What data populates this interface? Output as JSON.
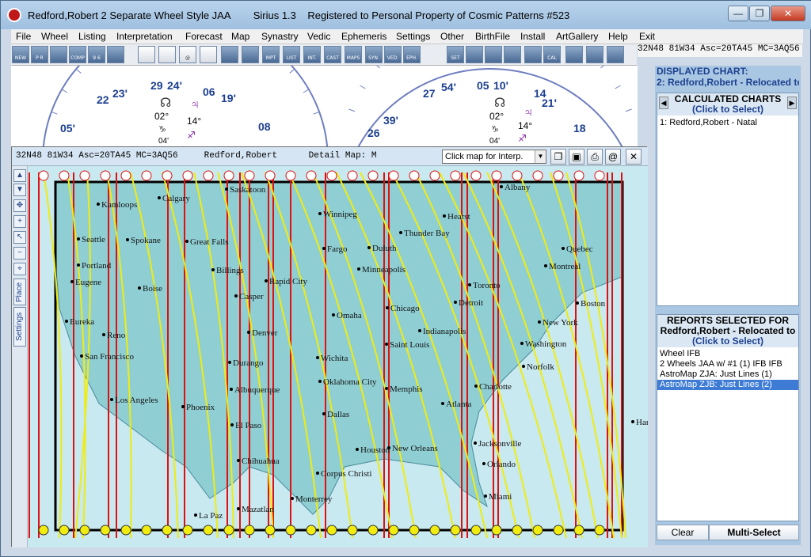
{
  "window": {
    "title": "Redford,Robert 2 Separate Wheel Style JAA        Sirius 1.3    Registered to Personal Property of Cosmic Patterns #523",
    "controls": [
      "—",
      "❐",
      "✕"
    ]
  },
  "menu": [
    "File",
    "Wheel",
    "Listing",
    "Interpretation",
    "Forecast",
    "Map",
    "Synastry",
    "Vedic",
    "Ephemeris",
    "Settings",
    "Other",
    "BirthFile",
    "Install",
    "ArtGallery",
    "Help",
    "Exit"
  ],
  "toolbar": {
    "buttons": [
      "NEW",
      "P R",
      "",
      "COMP",
      "9 6",
      "",
      "",
      "",
      "@",
      "",
      "",
      "",
      "MPT",
      "LIST",
      "INT.",
      "CAST",
      "MAPS",
      "SYN.",
      "VED.",
      "EPH.",
      "SET",
      "",
      "",
      "",
      "",
      "CAL",
      "",
      "",
      ""
    ]
  },
  "status_line": "32N48 81W34 Asc=20TA45 MC=3AQ56",
  "wheels": {
    "left": {
      "top_deg": "29",
      "top_sign": "24'",
      "d1": "23'",
      "d1b": "22",
      "d2": "06",
      "d2b": "19'",
      "d3": "05'",
      "d4": "08",
      "g1": "02°",
      "g2": "14°",
      "g3": "04'"
    },
    "right": {
      "top_deg": "05",
      "top_sign": "10'",
      "d1": "54'",
      "d1b": "27",
      "d2": "14",
      "d2b": "21'",
      "d3": "39'",
      "d3b": "26",
      "d4": "18",
      "g1": "02°",
      "g2": "14°",
      "g3": "04'"
    }
  },
  "map_window": {
    "header": "32N48 81W34 Asc=20TA45 MC=3AQ56     Redford,Robert      Detail Map: M",
    "select_value": "Click map for Interp.",
    "side_label_place": "Place",
    "side_label_settings": "Settings",
    "cities": [
      "Kamloops",
      "Calgary",
      "Saskatoon",
      "Winnipeg",
      "Seattle",
      "Spokane",
      "Great Falls",
      "Portland",
      "Billings",
      "Eugene",
      "Boise",
      "Casper",
      "Rapid City",
      "Fargo",
      "Duluth",
      "Minneapolis",
      "Thunder Bay",
      "Hearst",
      "Toronto",
      "Montreal",
      "Quebec",
      "Boston",
      "New York",
      "Eureka",
      "Reno",
      "Denver",
      "Omaha",
      "Chicago",
      "Indianapolis",
      "Washington",
      "Norfolk",
      "San Francisco",
      "Durango",
      "Wichita",
      "Saint Louis",
      "Los Angeles",
      "Albuquerque",
      "Oklahoma City",
      "Memphis",
      "Charlotte",
      "Atlanta",
      "Phoenix",
      "El Paso",
      "Dallas",
      "Houston",
      "New Orleans",
      "Jacksonville",
      "Orlando",
      "Miami",
      "Chihuahua",
      "Corpus Christi",
      "Monterrey",
      "La Paz",
      "Mazatlan",
      "Han",
      "Albany",
      "Detroit"
    ]
  },
  "right_panel": {
    "displayed_label": "DISPLAYED CHART:",
    "displayed_value": "2: Redford,Robert - Relocated to",
    "calculated_title": "CALCULATED CHARTS",
    "calculated_click": "(Click to Select)",
    "calculated_items": [
      "1: Redford,Robert - Natal"
    ],
    "reports_title": "REPORTS SELECTED FOR",
    "reports_sub": "Redford,Robert - Relocated to",
    "reports_click": "(Click to Select)",
    "report_items": [
      "Wheel IFB",
      "2 Wheels JAA w/ #1 (1) IFB IFB",
      "AstroMap ZJA: Just Lines (1)",
      "AstroMap ZJB: Just Lines (2)"
    ],
    "clear_label": "Clear",
    "multiselect_label": "Multi-Select"
  },
  "colors": {
    "map_land": "#8fcfd4",
    "map_sea": "#c8e9f0",
    "red_line": "#e01010",
    "yellow_line": "#f0ec10",
    "title_blue": "#1c3f8f"
  }
}
